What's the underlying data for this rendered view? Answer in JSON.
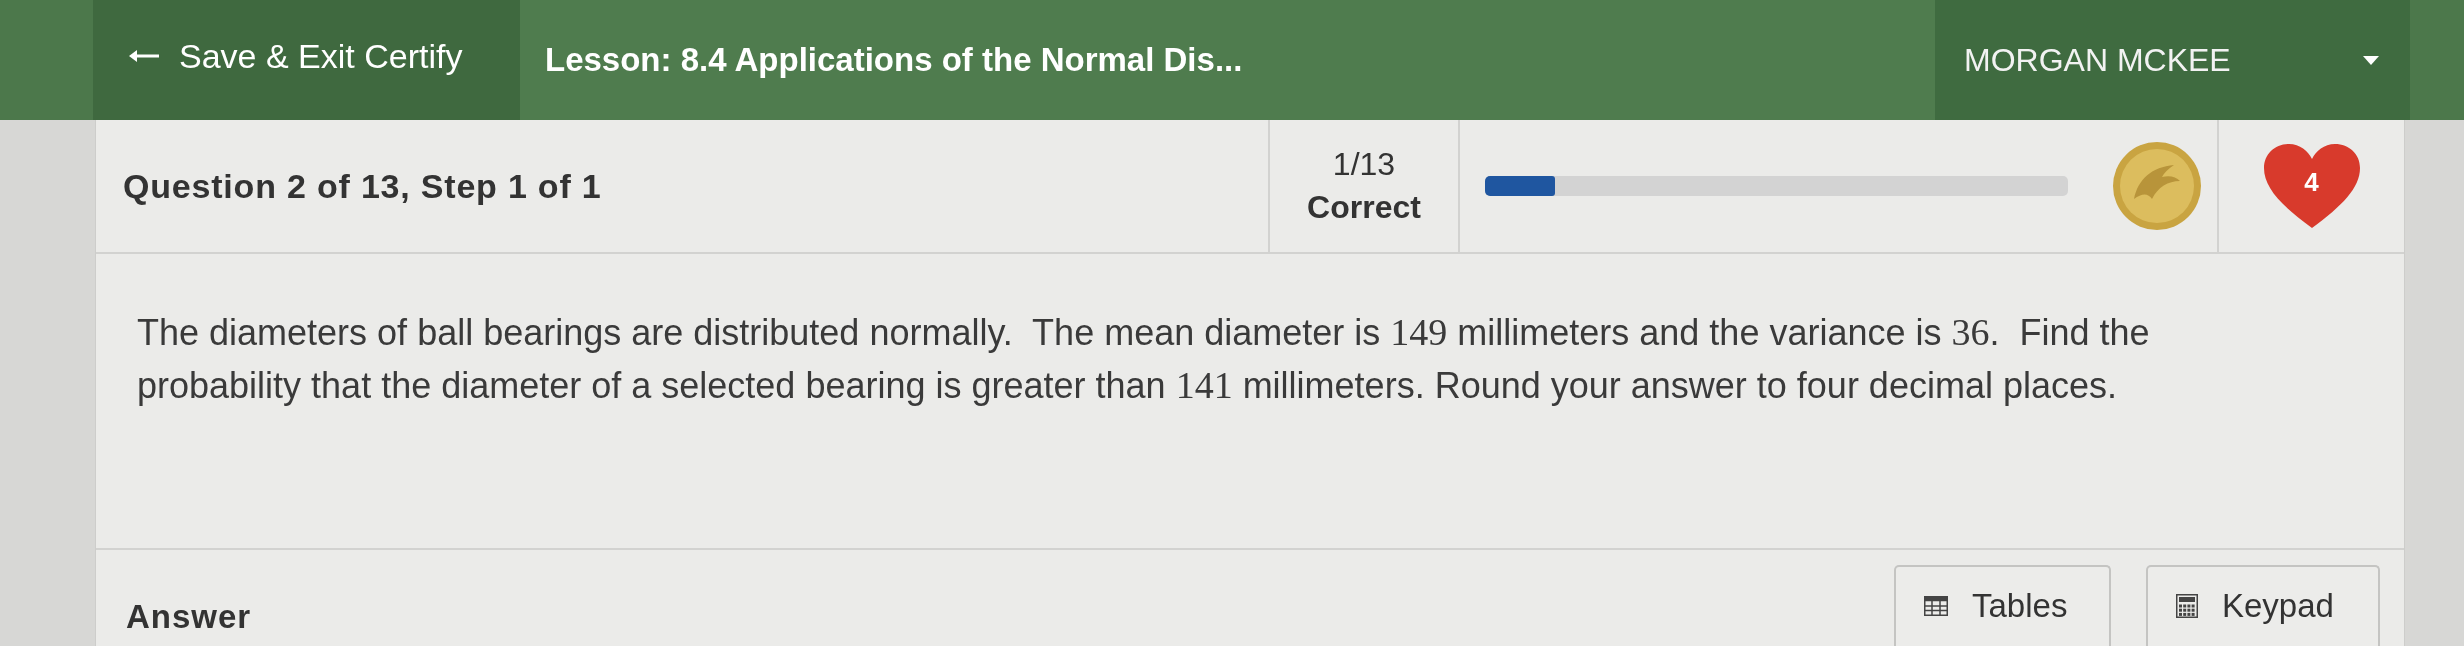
{
  "header": {
    "exit_button": {
      "label": "Save & Exit Certify"
    },
    "lesson_title": "Lesson: 8.4 Applications of the Normal Dis...",
    "user_menu": {
      "name": "MORGAN MCKEE"
    }
  },
  "status_bar": {
    "question_label": "Question 2 of 13, Step 1 of 1",
    "score": {
      "fraction": "1/13",
      "label": "Correct"
    },
    "progress": {
      "level": 0.12
    },
    "lives": {
      "count": "4"
    }
  },
  "question": {
    "segments": [
      {
        "kind": "text",
        "text": "The diameters of ball bearings are distributed normally.  The mean diameter is "
      },
      {
        "kind": "math",
        "text": "149"
      },
      {
        "kind": "text",
        "text": " millimeters and the variance is "
      },
      {
        "kind": "math",
        "text": "36"
      },
      {
        "kind": "text",
        "text": ".  Find the probability that the diameter of a selected bearing is greater than "
      },
      {
        "kind": "math",
        "text": "141"
      },
      {
        "kind": "text",
        "text": " millimeters. Round your answer to four decimal places."
      }
    ]
  },
  "answer": {
    "label": "Answer",
    "tools": [
      {
        "kind": "table",
        "label": "Tables"
      },
      {
        "kind": "calculator",
        "label": "Keypad"
      }
    ]
  }
}
